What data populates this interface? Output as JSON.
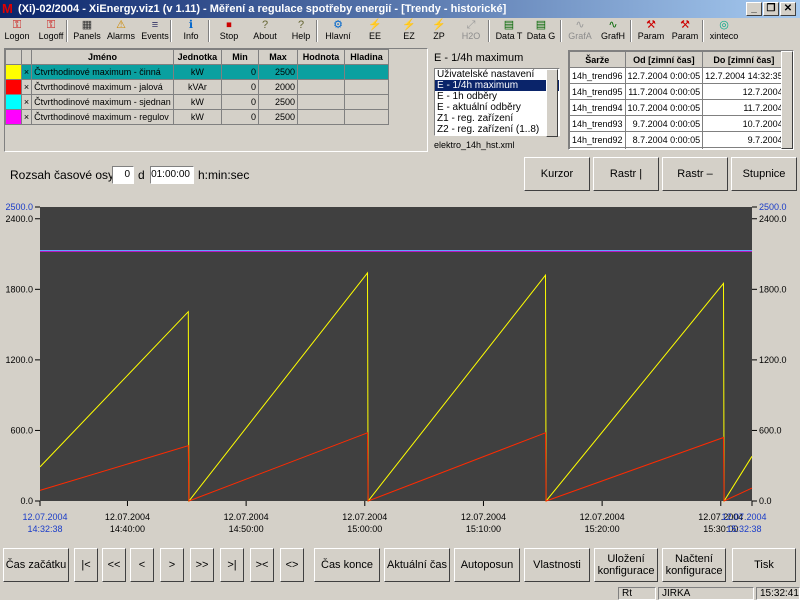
{
  "window": {
    "title": "(Xi)-02/2004 - XiEnergy.viz1 (v 1.11) - Měření a regulace spotřeby energií - [Trendy - historické]"
  },
  "toolbar": [
    {
      "label": "Logon",
      "icon": "key-icon",
      "enabled": true
    },
    {
      "label": "Logoff",
      "icon": "key-x-icon",
      "enabled": true
    },
    {
      "label": "Panels",
      "icon": "panels-icon",
      "enabled": true
    },
    {
      "label": "Alarms",
      "icon": "alarms-icon",
      "enabled": true
    },
    {
      "label": "Events",
      "icon": "events-icon",
      "enabled": true
    },
    {
      "label": "Info",
      "icon": "info-icon",
      "enabled": true
    },
    {
      "label": "Stop",
      "icon": "stop-icon",
      "enabled": true
    },
    {
      "label": "About",
      "icon": "about-icon",
      "enabled": true
    },
    {
      "label": "Help",
      "icon": "help-icon",
      "enabled": true
    },
    {
      "label": "Hlavní",
      "icon": "main-icon",
      "enabled": true
    },
    {
      "label": "EE",
      "icon": "ee-icon",
      "enabled": true
    },
    {
      "label": "EZ",
      "icon": "ez-icon",
      "enabled": true
    },
    {
      "label": "ZP",
      "icon": "zp-icon",
      "enabled": true
    },
    {
      "label": "H2O",
      "icon": "h2o-icon",
      "enabled": false
    },
    {
      "label": "Data T",
      "icon": "data-t-icon",
      "enabled": true
    },
    {
      "label": "Data G",
      "icon": "data-g-icon",
      "enabled": true
    },
    {
      "label": "GrafA",
      "icon": "graf-a-icon",
      "enabled": false
    },
    {
      "label": "GrafH",
      "icon": "graf-h-icon",
      "enabled": true
    },
    {
      "label": "Param",
      "icon": "param-icon",
      "enabled": true
    },
    {
      "label": "Param",
      "icon": "param2-icon",
      "enabled": true
    },
    {
      "label": "xinteco",
      "icon": "xinteco-icon",
      "enabled": true
    }
  ],
  "var_table": {
    "headers": [
      "Jméno",
      "Jednotka",
      "Min",
      "Max",
      "Hodnota",
      "Hladina"
    ],
    "rows": [
      {
        "color": "#ffff00",
        "name": "Čtvrthodinové maximum - činná",
        "unit": "kW",
        "min": "0",
        "max": "2500",
        "value": "",
        "level": ""
      },
      {
        "color": "#ff0000",
        "name": "Čtvrthodinové maximum - jalová",
        "unit": "kVAr",
        "min": "0",
        "max": "2000",
        "value": "",
        "level": ""
      },
      {
        "color": "#00ffff",
        "name": "Čtvrthodinové maximum - sjednan",
        "unit": "kW",
        "min": "0",
        "max": "2500",
        "value": "",
        "level": ""
      },
      {
        "color": "#ff00ff",
        "name": "Čtvrthodinové maximum - regulov",
        "unit": "kW",
        "min": "0",
        "max": "2500",
        "value": "",
        "level": ""
      }
    ]
  },
  "trend_list": {
    "selected_header": "E - 1/4h maximum",
    "items": [
      "Uživatelské nastavení",
      "E - 1/4h maximum",
      "E - 1h odběry",
      "E - aktuální odběry",
      "Z1 - reg. zařízení",
      "Z2 - reg. zařízení (1..8)"
    ],
    "selected_index": 1,
    "file": "elektro_14h_hst.xml"
  },
  "batch_table": {
    "headers": [
      "Šarže",
      "Od [zimní čas]",
      "Do [zimní čas]"
    ],
    "rows": [
      [
        "14h_trend96",
        "12.7.2004 0:00:05",
        "12.7.2004 14:32:35"
      ],
      [
        "14h_trend95",
        "11.7.2004 0:00:05",
        "12.7.2004"
      ],
      [
        "14h_trend94",
        "10.7.2004 0:00:05",
        "11.7.2004"
      ],
      [
        "14h_trend93",
        "9.7.2004 0:00:05",
        "10.7.2004"
      ],
      [
        "14h_trend92",
        "8.7.2004 0:00:05",
        "9.7.2004"
      ],
      [
        "14h_trend91",
        "7.7.2004 0:00:05",
        "8.7.2004"
      ]
    ]
  },
  "range": {
    "label": "Rozsah časové osy",
    "days": "0",
    "days_unit": "d",
    "time": "01:00:00",
    "time_unit": "h:min:sec"
  },
  "chart_buttons": [
    "Kurzor",
    "Rastr |",
    "Rastr –",
    "Stupnice"
  ],
  "chart_data": {
    "type": "line",
    "ylim": [
      0,
      2500
    ],
    "y_ticks": [
      "2500.0",
      "2400.0",
      "1800.0",
      "1200.0",
      "600.0",
      "0.0"
    ],
    "x_ticks": [
      {
        "date": "12.07.2004",
        "time": "14:32:38",
        "highlight": true
      },
      {
        "date": "12.07.2004",
        "time": "14:40:00",
        "highlight": false
      },
      {
        "date": "12.07.2004",
        "time": "14:50:00",
        "highlight": false
      },
      {
        "date": "12.07.2004",
        "time": "15:00:00",
        "highlight": false
      },
      {
        "date": "12.07.2004",
        "time": "15:10:00",
        "highlight": false
      },
      {
        "date": "12.07.2004",
        "time": "15:20:00",
        "highlight": false
      },
      {
        "date": "12.07.2004",
        "time": "15:30:00",
        "highlight": false
      },
      {
        "date": "12.07.2004",
        "time": "15:32:38",
        "highlight": true
      }
    ],
    "xlim_minutes": [
      0,
      60
    ],
    "series": [
      {
        "color": "#ffff00",
        "points": [
          [
            0,
            290
          ],
          [
            12.5,
            1610
          ],
          [
            12.55,
            0
          ],
          [
            27.6,
            1940
          ],
          [
            27.65,
            0
          ],
          [
            42.6,
            1920
          ],
          [
            42.65,
            0
          ],
          [
            57.6,
            1850
          ],
          [
            57.65,
            0
          ],
          [
            60,
            380
          ]
        ]
      },
      {
        "color": "#ff2a00",
        "points": [
          [
            0,
            90
          ],
          [
            12.5,
            470
          ],
          [
            12.55,
            0
          ],
          [
            27.6,
            580
          ],
          [
            27.65,
            0
          ],
          [
            42.6,
            580
          ],
          [
            42.65,
            0
          ],
          [
            57.6,
            540
          ],
          [
            57.65,
            0
          ],
          [
            60,
            110
          ]
        ]
      },
      {
        "color": "#00ffff",
        "points": [
          [
            0,
            2130
          ],
          [
            60,
            2130
          ]
        ]
      },
      {
        "color": "#ff00ff",
        "points": [
          [
            0,
            2125
          ],
          [
            60,
            2125
          ]
        ]
      }
    ]
  },
  "nav_buttons": [
    "Čas začátku",
    "|<",
    "<<",
    "<",
    ">",
    ">>",
    ">|",
    "><",
    "<>",
    "Čas konce",
    "Aktuální čas",
    "Autoposun",
    "Vlastnosti",
    "Uložení konfigurace",
    "Načtení konfigurace",
    "Tisk"
  ],
  "status": {
    "mode": "Rt",
    "user": "JIRKA",
    "time": "15:32:41"
  }
}
